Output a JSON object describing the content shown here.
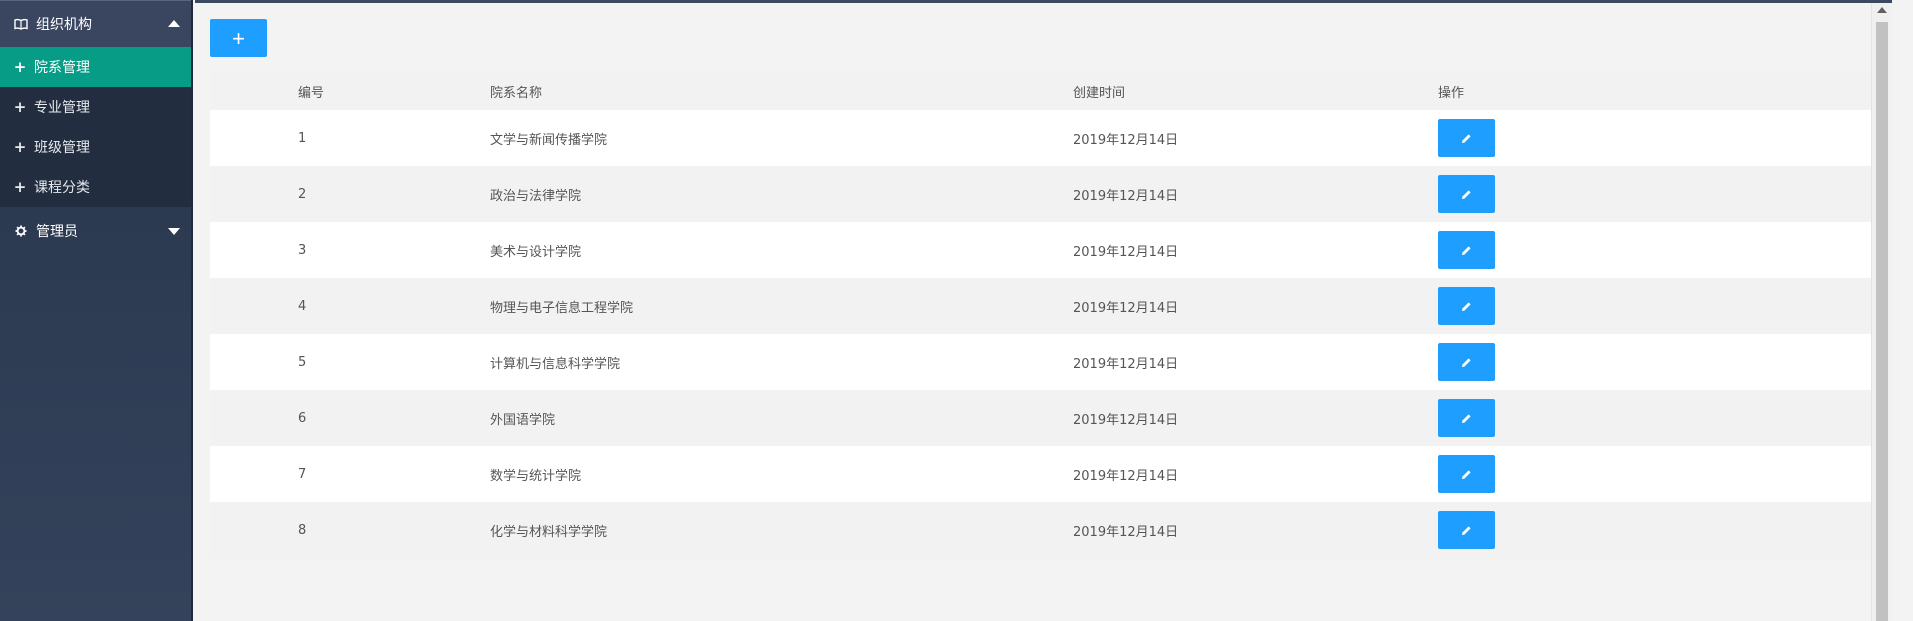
{
  "sidebar": {
    "org_group": {
      "label": "组织机构",
      "icon": "book-icon"
    },
    "items": [
      {
        "label": "院系管理",
        "active": true
      },
      {
        "label": "专业管理",
        "active": false
      },
      {
        "label": "班级管理",
        "active": false
      },
      {
        "label": "课程分类",
        "active": false
      }
    ],
    "admin_group": {
      "label": "管理员",
      "icon": "gear-icon"
    }
  },
  "toolbar": {
    "add_label": "+"
  },
  "table": {
    "headers": {
      "id": "编号",
      "name": "院系名称",
      "created": "创建时间",
      "action": "操作"
    },
    "rows": [
      {
        "id": "1",
        "name": "文学与新闻传播学院",
        "created": "2019年12月14日"
      },
      {
        "id": "2",
        "name": "政治与法律学院",
        "created": "2019年12月14日"
      },
      {
        "id": "3",
        "name": "美术与设计学院",
        "created": "2019年12月14日"
      },
      {
        "id": "4",
        "name": "物理与电子信息工程学院",
        "created": "2019年12月14日"
      },
      {
        "id": "5",
        "name": "计算机与信息科学学院",
        "created": "2019年12月14日"
      },
      {
        "id": "6",
        "name": "外国语学院",
        "created": "2019年12月14日"
      },
      {
        "id": "7",
        "name": "数学与统计学院",
        "created": "2019年12月14日"
      },
      {
        "id": "8",
        "name": "化学与材料科学学院",
        "created": "2019年12月14日"
      }
    ]
  },
  "colors": {
    "accent": "#1e9fff",
    "active_menu": "#079c86",
    "sidebar_bg": "#2c3a52"
  }
}
